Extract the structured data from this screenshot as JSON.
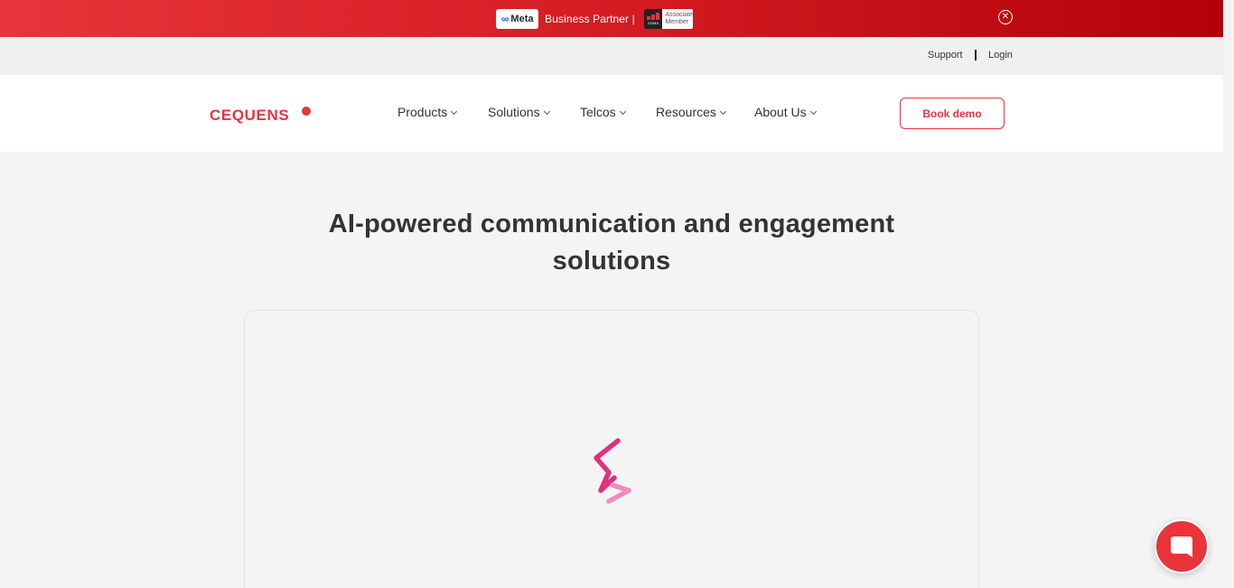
{
  "promo": {
    "meta_label": "Meta",
    "text": "Business Partner |",
    "gsma_label": "GSMA",
    "gsma_text": "Associate Member"
  },
  "utility": {
    "support": "Support",
    "login": "Login"
  },
  "header": {
    "logo": "CEQUENS",
    "nav": [
      {
        "label": "Products"
      },
      {
        "label": "Solutions"
      },
      {
        "label": "Telcos"
      },
      {
        "label": "Resources"
      },
      {
        "label": "About Us"
      }
    ],
    "cta": "Book demo"
  },
  "hero": {
    "title_line1": "AI-powered communication and engagement",
    "title_line2": "solutions"
  },
  "colors": {
    "brand_red": "#e8343a",
    "banner_dark_red": "#b20208",
    "spinner_magenta": "#e0307e",
    "spinner_pink": "#f18cbb"
  },
  "icons": {
    "close": "close-circle-icon",
    "chevron": "chevron-down-icon",
    "chat": "chat-icon",
    "loader": "loading-spinner-icon"
  }
}
